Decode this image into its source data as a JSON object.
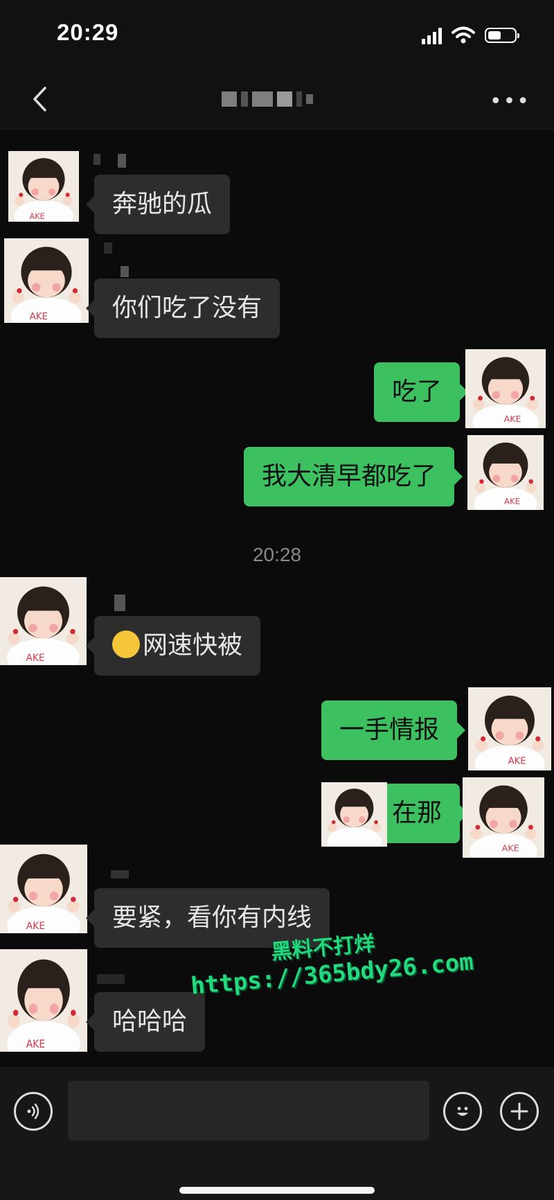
{
  "status_bar": {
    "time": "20:29"
  },
  "chat": {
    "messages": [
      {
        "side": "in",
        "text": "奔驰的瓜"
      },
      {
        "side": "in",
        "text": "你们吃了没有"
      },
      {
        "side": "out",
        "text": "吃了"
      },
      {
        "side": "out",
        "text": "我大清早都吃了"
      },
      {
        "side": "in",
        "text": "网速快被",
        "emoji": "thinking-face"
      },
      {
        "side": "out",
        "text": "一手情报"
      },
      {
        "side": "out",
        "text": "在那"
      },
      {
        "side": "in",
        "text": "要紧，看你有内线"
      },
      {
        "side": "in",
        "text": "哈哈哈"
      }
    ],
    "timestamp": "20:28"
  },
  "watermark": {
    "line1": "黑料不打烊",
    "line2": "https://365bdy26.com"
  },
  "colors": {
    "outgoing_bubble": "#3cc060",
    "incoming_bubble": "#2d2d2d",
    "background": "#0b0b0b"
  },
  "icons": [
    "back-icon",
    "more-icon",
    "voice-icon",
    "emoji-icon",
    "plus-icon"
  ]
}
